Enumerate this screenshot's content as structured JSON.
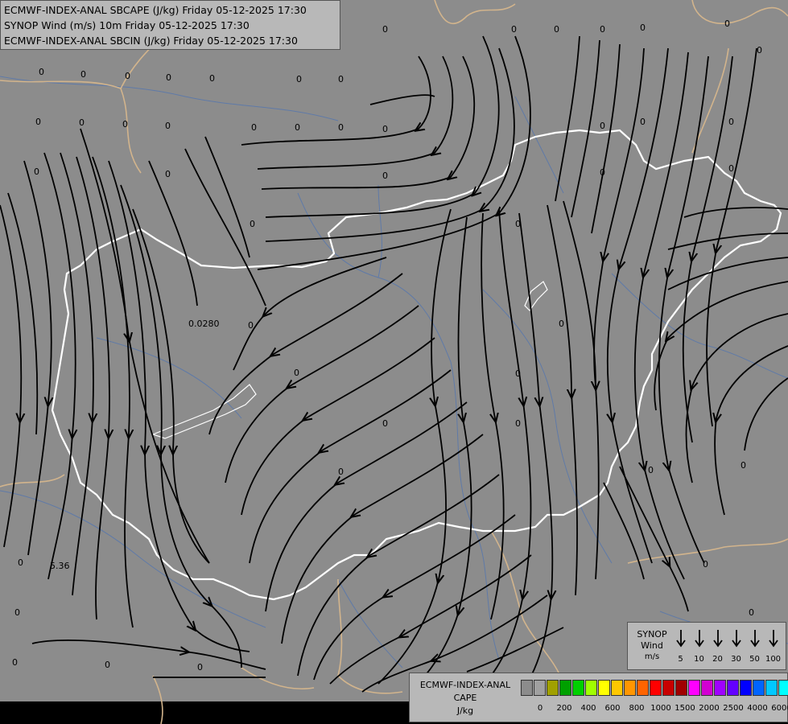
{
  "title_lines": [
    "ECMWF-INDEX-ANAL SBCAPE (J/kg) Friday 05-12-2025 17:30",
    "SYNOP Wind (m/s) 10m Friday 05-12-2025 17:30",
    "ECMWF-INDEX-ANAL SBCIN (J/kg) Friday 05-12-2025 17:30"
  ],
  "colors": {
    "background": "#8c8c8c",
    "hungary_border": "#ffffff",
    "country_borders": "#d2b48c",
    "rivers": "#5f7aa8",
    "streamlines": "#000000"
  },
  "map_labels": [
    {
      "text": "0"
    },
    {
      "text": "0"
    },
    {
      "text": "0"
    },
    {
      "text": "0"
    },
    {
      "text": "0"
    },
    {
      "text": "0"
    },
    {
      "text": "0"
    },
    {
      "text": "0"
    },
    {
      "text": "0"
    },
    {
      "text": "0"
    },
    {
      "text": "0"
    },
    {
      "text": "0"
    },
    {
      "text": "0"
    },
    {
      "text": "0"
    },
    {
      "text": "0"
    },
    {
      "text": "0"
    },
    {
      "text": "0"
    },
    {
      "text": "0"
    },
    {
      "text": "0"
    },
    {
      "text": "0"
    },
    {
      "text": "0"
    },
    {
      "text": "0"
    },
    {
      "text": "0"
    },
    {
      "text": "0"
    },
    {
      "text": "0"
    },
    {
      "text": "0"
    },
    {
      "text": "0"
    },
    {
      "text": "0"
    },
    {
      "text": "0"
    },
    {
      "text": "0"
    },
    {
      "text": "0"
    },
    {
      "text": "0"
    },
    {
      "text": "0.0280"
    },
    {
      "text": "5.36"
    },
    {
      "text": "0"
    },
    {
      "text": "0"
    },
    {
      "text": "0"
    },
    {
      "text": "0"
    },
    {
      "text": "0"
    },
    {
      "text": "0"
    },
    {
      "text": "0"
    },
    {
      "text": "0"
    },
    {
      "text": "0"
    },
    {
      "text": "0"
    },
    {
      "text": "0"
    },
    {
      "text": "0"
    },
    {
      "text": "0"
    },
    {
      "text": "0"
    },
    {
      "text": "0"
    },
    {
      "text": "0"
    }
  ],
  "wind_legend": {
    "title_line1": "SYNOP",
    "title_line2": "Wind",
    "unit": "m/s",
    "speeds": [
      "5",
      "10",
      "20",
      "30",
      "50",
      "100"
    ]
  },
  "cape_legend": {
    "title_line1": "ECMWF-INDEX-ANAL",
    "title_line2": "CAPE",
    "unit": "J/kg",
    "swatch_colors": [
      "#8c8c8c",
      "#a0a0a0",
      "#a0a000",
      "#00a000",
      "#00d000",
      "#a0ff00",
      "#ffff00",
      "#ffc800",
      "#ff9600",
      "#ff6400",
      "#ff0000",
      "#c80000",
      "#a00000",
      "#ff00ff",
      "#d200d2",
      "#a000ff",
      "#6400ff",
      "#0000ff",
      "#0064ff",
      "#00c8ff",
      "#00ffff",
      "#ffffff"
    ],
    "tick_labels": [
      "0",
      "200",
      "400",
      "600",
      "800",
      "1000",
      "1500",
      "2000",
      "2500",
      "4000",
      "6000"
    ]
  }
}
